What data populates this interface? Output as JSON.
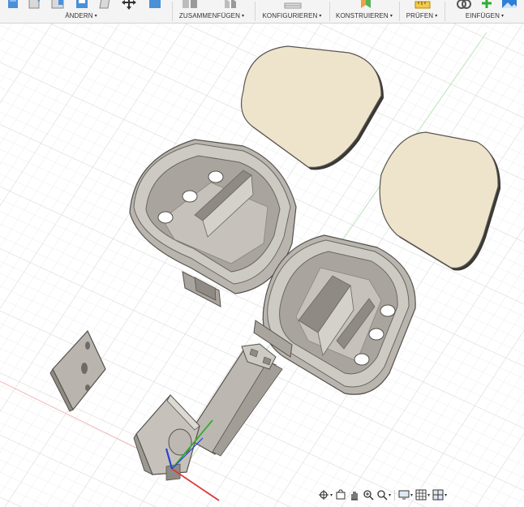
{
  "toolbar": {
    "groups": [
      {
        "label": "ÄNDERN"
      },
      {
        "label": "ZUSAMMENFÜGEN"
      },
      {
        "label": "KONFIGURIEREN"
      },
      {
        "label": "KONSTRUIEREN"
      },
      {
        "label": "PRÜFEN"
      },
      {
        "label": "EINFÜGEN"
      }
    ],
    "dropdown_caret": "▾"
  },
  "colors": {
    "toolbar_bg": "#f4f4f4",
    "grid_minor": "#ececec",
    "grid_major": "#d8d8d8",
    "part_face": "#c8c5bf",
    "part_dark": "#9c9892",
    "lid_face": "#eee4cc",
    "axis_x": "#d83a3a",
    "axis_y": "#2fae2f",
    "axis_z": "#2a3fd6"
  },
  "navbar": {
    "tools": [
      "orbit-icon",
      "look-at-icon",
      "pan-icon",
      "zoom-window-icon",
      "fit-icon",
      "display-settings-icon",
      "grid-settings-icon",
      "viewports-icon"
    ]
  }
}
